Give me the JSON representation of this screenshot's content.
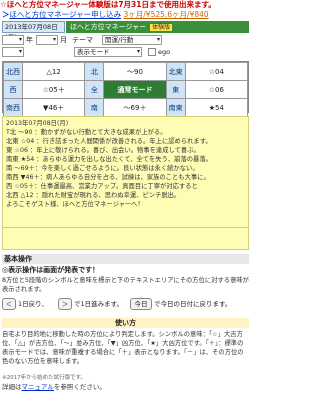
{
  "notice": "☆ほへと方位マネージャー体験版は7月31日まで使用出来ます。",
  "subscribe": {
    "prefix": "＞",
    "link": "ほへと方位マネージャー申し込み",
    "price": "3ヶ月/¥525,6ヶ月/¥840"
  },
  "header": {
    "date": "2013年07月08日(月)",
    "title": "ほへと方位マネージャー",
    "tag": "体験版"
  },
  "controls": {
    "nen_label": "年",
    "nen_value": "",
    "tsuki_label": "月",
    "tsuki_value": "",
    "theme_label": "テーマ",
    "theme_value": "開運/行動",
    "display_value": "表示モード",
    "ego_label": "ego",
    "select2_value": ""
  },
  "grid": {
    "rows": [
      [
        {
          "dir": "北西",
          "mark": "",
          "val": "△12"
        },
        {
          "dir": "北",
          "mark": "",
          "val": "～90"
        },
        {
          "dir": "北東",
          "mark": "",
          "val": "☆04"
        }
      ],
      [
        {
          "dir": "西",
          "mark": "",
          "val": "☆05＋"
        },
        {
          "dir": "全",
          "mark": "",
          "val": "通常モード",
          "center": true
        },
        {
          "dir": "東",
          "mark": "",
          "val": "☆06"
        }
      ],
      [
        {
          "dir": "南西",
          "mark": "",
          "val": "▼46＋"
        },
        {
          "dir": "南",
          "mark": "",
          "val": "～69＋"
        },
        {
          "dir": "南東",
          "mark": "",
          "val": "★54"
        }
      ]
    ]
  },
  "reading": [
    "2013年07月08日(月)",
    "T北 ～90 ：動かずがない行動とて大きな成果が上がる。",
    "北東 ☆04 ：行き詰まった人間関係が改善される。年上に認められます。",
    "東 ☆06 ：年上に敬けられる。喜び、出会い。物事を達成して喜ぶ。",
    "南東 ★54 ：あらゆる運力を出しな出たくて、全てを失う、崩落の暴落。",
    "南 ～69＋：今を楽しく過ごせるように。良い状態は永く続かない。",
    "南西 ▼46＋：病人あらゆる自分を占る、試練は、家族のことも大事に。",
    "西 ☆05＋：仕事運最高、営業力アップ。真面目に丁寧が対応すると",
    "北西 △12 ：隠れた財宝が現れる、思わぬ幸運、ピンチ脱出。",
    "よろこそゲスト様、ほへと方位マネージャーへ！"
  ],
  "basic": {
    "heading": "基本操作",
    "ops_title": "◎表示操作は画面が発表です！",
    "ops_desc": "8方位と5段階のシンボルと意味を標示と下のテキストエリアにその方位に対する意味が表示されます。"
  },
  "nav": {
    "prev_btn": "＜",
    "prev_text": "1日戻り、",
    "next_btn": "＞",
    "next_text": "で1日進みます。",
    "today_btn": "今日",
    "today_text": "で今日の日付に戻ります。"
  },
  "usage": {
    "heading": "使い方",
    "text": "自宅より目的地に移動した時の方位により判定します。シンボルの意味：「☆」大吉方位、「△」が吉方位、「～」並み方位、「▼」凶方位、「★」大凶方位です。「＋」：標準の表示モードでは、意味が重複する場合に「＋」表示となります。「－」は、その方位の色のない方位を意味します。"
  },
  "footnote": "※2017年から始めた試行版です。",
  "manual": {
    "prefix": "詳細は",
    "link": "マニュアル",
    "suffix": "を参照ください。"
  }
}
